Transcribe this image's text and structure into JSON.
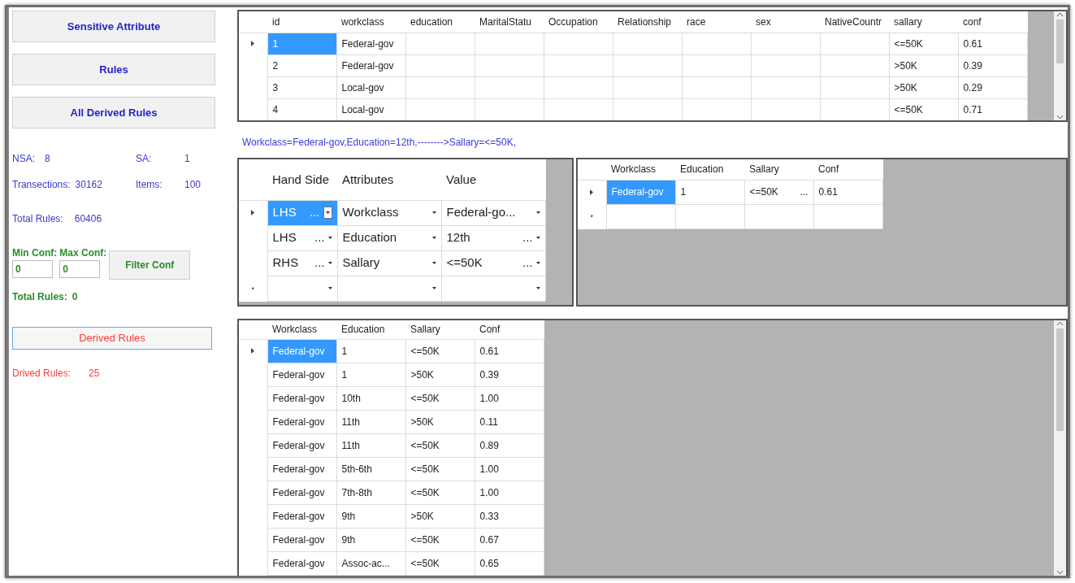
{
  "sidebar": {
    "nav_buttons": [
      "Sensitive Attribute",
      "Rules",
      "All Derived Rules"
    ],
    "stats": [
      {
        "label": "NSA:",
        "value": "8"
      },
      {
        "label": "SA:",
        "value": "1"
      },
      {
        "label": "Transections:",
        "value": "30162"
      },
      {
        "label": "Items:",
        "value": "100"
      }
    ],
    "total_rules": {
      "label": "Total Rules:",
      "value": "60406"
    },
    "conf_filter": {
      "min_label": "Min Conf:",
      "min_value": "0",
      "max_label": "Max Conf:",
      "max_value": "0",
      "button": "Filter Conf"
    },
    "filtered_total": {
      "label": "Total Rules:",
      "value": "0"
    },
    "derived_button": "Derived Rules",
    "derived_count": {
      "label": "Drived Rules:",
      "value": "25"
    }
  },
  "records_grid": {
    "columns": [
      "id",
      "workclass",
      "education",
      "MaritalStatu",
      "Occupation",
      "Relationship",
      "race",
      "sex",
      "NativeCountr",
      "sallary",
      "conf"
    ],
    "rows": [
      {
        "selected": true,
        "cells": [
          "1",
          "Federal-gov",
          null,
          null,
          null,
          null,
          null,
          null,
          null,
          "<=50K",
          "0.61"
        ]
      },
      {
        "selected": false,
        "cells": [
          "2",
          "Federal-gov",
          null,
          null,
          null,
          null,
          null,
          null,
          null,
          ">50K",
          "0.39"
        ]
      },
      {
        "selected": false,
        "cells": [
          "3",
          "Local-gov",
          null,
          null,
          null,
          null,
          null,
          null,
          null,
          ">50K",
          "0.29"
        ]
      },
      {
        "selected": false,
        "cells": [
          "4",
          "Local-gov",
          null,
          null,
          null,
          null,
          null,
          null,
          null,
          "<=50K",
          "0.71"
        ]
      }
    ]
  },
  "rule_text": "Workclass=Federal-gov,Education=12th,-------->Sallary=<=50K,",
  "rule_editor": {
    "columns": [
      "Hand Side",
      "Attributes",
      "Value"
    ],
    "rows": [
      {
        "selected": true,
        "cells": [
          {
            "text": "LHS",
            "more": "..."
          },
          {
            "text": "Workclass"
          },
          {
            "text": "Federal-go..."
          }
        ]
      },
      {
        "selected": false,
        "cells": [
          {
            "text": "LHS",
            "more": "..."
          },
          {
            "text": "Education"
          },
          {
            "text": "12th",
            "more": "..."
          }
        ]
      },
      {
        "selected": false,
        "cells": [
          {
            "text": "RHS",
            "more": "..."
          },
          {
            "text": "Sallary"
          },
          {
            "text": "<=50K",
            "more": "..."
          }
        ]
      }
    ],
    "new_row": "*"
  },
  "rule_match_grid": {
    "columns": [
      "Workclass",
      "Education",
      "Sallary",
      "Conf"
    ],
    "rows": [
      {
        "selected": true,
        "cells": [
          "Federal-gov",
          "1",
          "<=50K",
          "0.61"
        ],
        "more": "..."
      }
    ],
    "new_row": "*"
  },
  "derived_grid": {
    "columns": [
      "Workclass",
      "Education",
      "Sallary",
      "Conf"
    ],
    "rows": [
      {
        "selected": true,
        "cells": [
          "Federal-gov",
          "1",
          "<=50K",
          "0.61"
        ]
      },
      {
        "selected": false,
        "cells": [
          "Federal-gov",
          "1",
          ">50K",
          "0.39"
        ]
      },
      {
        "selected": false,
        "cells": [
          "Federal-gov",
          "10th",
          "<=50K",
          "1.00"
        ]
      },
      {
        "selected": false,
        "cells": [
          "Federal-gov",
          "11th",
          ">50K",
          "0.11"
        ]
      },
      {
        "selected": false,
        "cells": [
          "Federal-gov",
          "11th",
          "<=50K",
          "0.89"
        ]
      },
      {
        "selected": false,
        "cells": [
          "Federal-gov",
          "5th-6th",
          "<=50K",
          "1.00"
        ]
      },
      {
        "selected": false,
        "cells": [
          "Federal-gov",
          "7th-8th",
          "<=50K",
          "1.00"
        ]
      },
      {
        "selected": false,
        "cells": [
          "Federal-gov",
          "9th",
          ">50K",
          "0.33"
        ]
      },
      {
        "selected": false,
        "cells": [
          "Federal-gov",
          "9th",
          "<=50K",
          "0.67"
        ]
      },
      {
        "selected": false,
        "cells": [
          "Federal-gov",
          "Assoc-ac...",
          "<=50K",
          "0.65"
        ]
      }
    ]
  }
}
